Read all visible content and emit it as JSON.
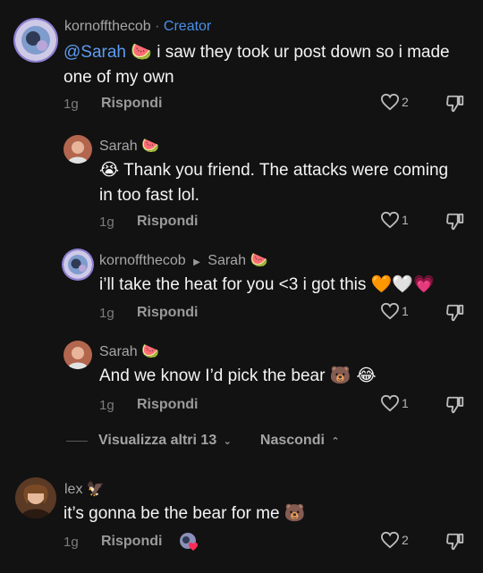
{
  "comment1": {
    "username": "kornoffthecob",
    "separator": "·",
    "badge": "Creator",
    "mention": "@Sarah",
    "mention_emoji": "🍉",
    "text_line1": "i saw they took ur post down so i made",
    "text_line2": "one of my own",
    "time": "1g",
    "reply_label": "Rispondi",
    "likes": "2"
  },
  "reply1": {
    "username": "Sarah",
    "name_emoji": "🍉",
    "lead_emoji": "😭",
    "text_line1": "Thank you friend. The attacks were coming",
    "text_line2": "in too fast lol.",
    "time": "1g",
    "reply_label": "Rispondi",
    "likes": "1"
  },
  "reply2": {
    "username": "kornoffthecob",
    "reply_to": "Sarah",
    "reply_to_emoji": "🍉",
    "text": "i’ll take the heat for you <3 i got this",
    "hearts": "🧡🤍💗",
    "time": "1g",
    "reply_label": "Rispondi",
    "likes": "1"
  },
  "reply3": {
    "username": "Sarah",
    "name_emoji": "🍉",
    "text": "And we know I’d pick the bear",
    "emojis": "🐻 😂",
    "time": "1g",
    "reply_label": "Rispondi",
    "likes": "1"
  },
  "thread_controls": {
    "view_more": "Visualizza altri 13",
    "hide": "Nascondi"
  },
  "comment2": {
    "username": "lex",
    "name_emoji": "🦅",
    "text": "it’s gonna be the bear for me",
    "text_emoji": "🐻",
    "time": "1g",
    "reply_label": "Rispondi",
    "likes": "2"
  }
}
